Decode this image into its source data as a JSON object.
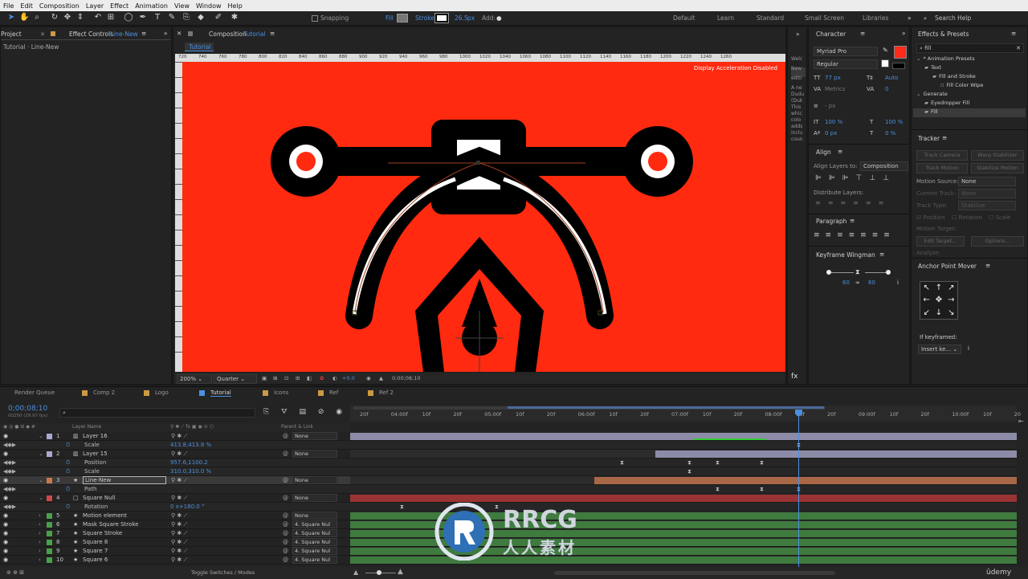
{
  "menu": [
    "File",
    "Edit",
    "Composition",
    "Layer",
    "Effect",
    "Animation",
    "View",
    "Window",
    "Help"
  ],
  "toolbar": {
    "snapping": "Snapping",
    "fill": "Fill",
    "stroke": "Stroke",
    "stroke_width": "26.5",
    "stroke_unit": "px",
    "add": "Add:",
    "workspaces": [
      "Default",
      "Learn",
      "Standard",
      "Small Screen",
      "Libraries"
    ],
    "search_help": "Search Help"
  },
  "left_panel": {
    "tab_project": "Project",
    "tab_effect_controls": "Effect Controls",
    "tab_effect_target": "Line-New",
    "subtitle": "Tutorial · Line-New"
  },
  "comp_panel": {
    "tab_label": "Composition",
    "tab_name": "Tutorial",
    "sub_tab": "Tutorial",
    "notice": "Display Acceleration Disabled",
    "ruler": [
      "20",
      "40",
      "60",
      "80",
      "100",
      "120",
      "140",
      "160",
      "180",
      "200",
      "220",
      "240",
      "260",
      "280",
      "300",
      "320",
      "340",
      "360",
      "380",
      "400",
      "420",
      "440",
      "460"
    ],
    "ruler_ticks": [
      "720",
      "740",
      "760",
      "780",
      "800",
      "820",
      "840",
      "860",
      "880",
      "900",
      "920",
      "940",
      "960",
      "980",
      "1000",
      "1020",
      "1040",
      "1060",
      "1080",
      "1100",
      "1120",
      "1140",
      "1160",
      "1180",
      "1200",
      "1220",
      "1240",
      "1260"
    ],
    "zoom": "200%",
    "resolution": "Quarter",
    "exposure": "+0.0",
    "timecode": "0;00;08;10"
  },
  "side_text": {
    "lines": [
      "Welc",
      "New",
      "editi",
      "A ne",
      "Dudu",
      "(Duk",
      "This",
      "whic",
      "colo",
      "adds",
      "inclu",
      "coun"
    ]
  },
  "character": {
    "title": "Character",
    "font": "Myriad Pro",
    "style": "Regular",
    "size": "77 px",
    "leading": "Auto",
    "kerning": "Metrics",
    "tracking": "0",
    "stroke_px": "- px",
    "vscale": "100 %",
    "hscale": "100 %",
    "baseline": "0 px",
    "tsume": "0 %",
    "color": "#ff2a1a"
  },
  "align": {
    "title": "Align",
    "align_to_label": "Align Layers to:",
    "align_to": "Composition",
    "distribute": "Distribute Layers:"
  },
  "paragraph": {
    "title": "Paragraph"
  },
  "keyframe_wingman": {
    "title": "Keyframe Wingman",
    "left_val": "60",
    "right_val": "60"
  },
  "effects_presets": {
    "title": "Effects & Presets",
    "search": "fill",
    "tree": [
      {
        "label": "* Animation Presets",
        "indent": 0
      },
      {
        "label": "Text",
        "indent": 1
      },
      {
        "label": "Fill and Stroke",
        "indent": 2
      },
      {
        "label": "Fill Color Wipe",
        "indent": 3
      },
      {
        "label": "Generate",
        "indent": 0
      },
      {
        "label": "Eyedropper Fill",
        "indent": 1
      },
      {
        "label": "Fill",
        "indent": 1
      }
    ]
  },
  "tracker": {
    "title": "Tracker",
    "btn_track_camera": "Track Camera",
    "btn_warp": "Warp Stabilizer",
    "btn_track_motion": "Track Motion",
    "btn_stabilize": "Stabilize Motion",
    "motion_source_label": "Motion Source:",
    "motion_source": "None",
    "current_track_label": "Current Track:",
    "current_track": "None",
    "track_type_label": "Track Type:",
    "track_type": "Stabilize",
    "position": "Position",
    "rotation": "Rotation",
    "scale": "Scale",
    "motion_target": "Motion Target:",
    "edit_target": "Edit Target...",
    "options": "Options...",
    "analyze": "Analyze:"
  },
  "anchor_mover": {
    "title": "Anchor Point Mover",
    "if_keyframed": "If keyframed:",
    "mode": "Insert ke..."
  },
  "timeline": {
    "tabs": [
      "Render Queue",
      "Comp 2",
      "Logo",
      "Tutorial",
      "Icons",
      "Ref",
      "Ref 2"
    ],
    "active_tab": "Tutorial",
    "timecode": "0;00;08;10",
    "frame_info": "00250 (29.97 fps)",
    "col_layer_name": "Layer Name",
    "col_parent": "Parent & Link",
    "footer": "Toggle Switches / Modes",
    "time_labels": [
      "20f",
      "04:00f",
      "10f",
      "20f",
      "05:00f",
      "10f",
      "20f",
      "06:00f",
      "10f",
      "20f",
      "07:00f",
      "10f",
      "20f",
      "08:00f",
      "10f",
      "20f",
      "09:00f",
      "10f",
      "20f",
      "10:00f",
      "10f",
      "20"
    ],
    "layers": [
      {
        "num": "1",
        "name": "Layer 16",
        "color": "#a9a9cf",
        "parent": "None",
        "prop": "Scale",
        "prop_val": "413.8,413.8 %"
      },
      {
        "num": "2",
        "name": "Layer 15",
        "color": "#a9a9cf",
        "parent": "None",
        "props": [
          {
            "name": "Position",
            "val": "957.6,1100.2"
          },
          {
            "name": "Scale",
            "val": "310.0,310.0 %"
          }
        ]
      },
      {
        "num": "3",
        "name": "Line-New",
        "color": "#c9784e",
        "parent": "None",
        "prop": "Path",
        "prop_val": ""
      },
      {
        "num": "4",
        "name": "Square Null",
        "color": "#d04848",
        "parent": "None",
        "prop": "Rotation",
        "prop_val": "0 x+180.0 °"
      },
      {
        "num": "5",
        "name": "Motion element",
        "color": "#4aa04a",
        "parent": "None"
      },
      {
        "num": "6",
        "name": "Mask Square Stroke",
        "color": "#4aa04a",
        "parent": "4. Square Nul"
      },
      {
        "num": "7",
        "name": "Square Stroke",
        "color": "#4aa04a",
        "parent": "4. Square Nul"
      },
      {
        "num": "8",
        "name": "Square 8",
        "color": "#4aa04a",
        "parent": "4. Square Nul"
      },
      {
        "num": "9",
        "name": "Square 7",
        "color": "#4aa04a",
        "parent": "4. Square Nul"
      },
      {
        "num": "10",
        "name": "Square 6",
        "color": "#4aa04a",
        "parent": "4. Square Nul"
      }
    ]
  },
  "watermark": {
    "brand": "RRCG",
    "sub": "人人素材"
  },
  "udemy": "ûdemy"
}
